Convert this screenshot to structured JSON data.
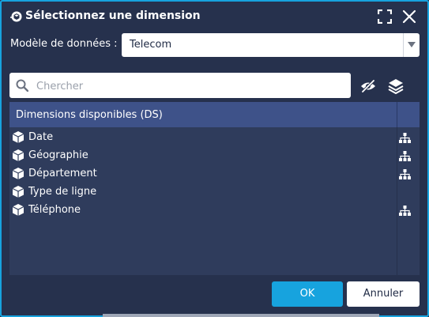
{
  "dialog": {
    "title": "Sélectionnez une dimension",
    "accent_color": "#17a3de",
    "background_color": "#26314d"
  },
  "model": {
    "label": "Modèle de données :",
    "value": "Telecom"
  },
  "search": {
    "placeholder": "Chercher"
  },
  "toolbar": {
    "hide_icon": "eye-slash-icon",
    "layers_icon": "layers-icon"
  },
  "list": {
    "header": "Dimensions disponibles (DS)",
    "items": [
      {
        "label": "Date",
        "hierarchy": true
      },
      {
        "label": "Géographie",
        "hierarchy": true
      },
      {
        "label": "Département",
        "hierarchy": true
      },
      {
        "label": "Type de ligne",
        "hierarchy": false
      },
      {
        "label": "Téléphone",
        "hierarchy": true
      }
    ]
  },
  "buttons": {
    "ok": "OK",
    "cancel": "Annuler"
  }
}
